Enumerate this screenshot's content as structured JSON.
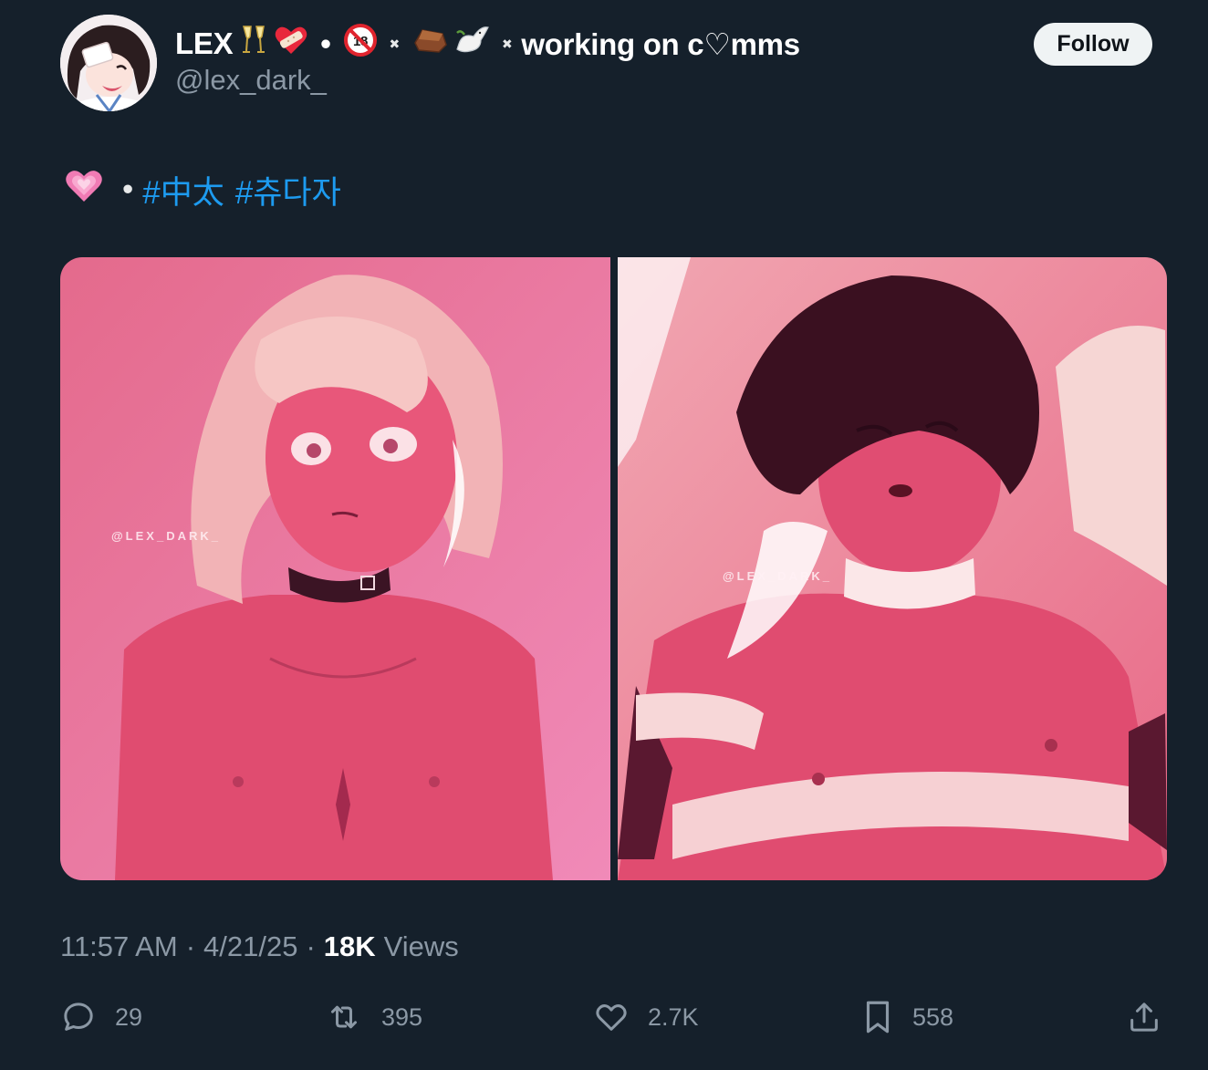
{
  "author": {
    "display_name": "LEX",
    "name_emojis": [
      "clinking-glasses",
      "mending-heart",
      "no-one-under-18",
      "coffin",
      "dove"
    ],
    "bio_tag": "working on c♡mms",
    "handle": "@lex_dark_",
    "follow_label": "Follow"
  },
  "tweet": {
    "lead_emoji": "pink-heart",
    "separator": "•",
    "hashtags": [
      "#中太",
      "#츄다자"
    ]
  },
  "media": {
    "left_watermark": "@LEX_DARK_",
    "right_watermark": "@LEX_DARK_"
  },
  "meta": {
    "time": "11:57 AM",
    "date": "4/21/25",
    "views_count": "18K",
    "views_label": "Views",
    "separator": "·"
  },
  "actions": {
    "replies": "29",
    "reposts": "395",
    "likes": "2.7K",
    "bookmarks": "558"
  },
  "colors": {
    "background": "#15202b",
    "hashtag": "#1d9bf0",
    "secondary_text": "#8b98a5",
    "follow_button": "#eff3f4"
  }
}
